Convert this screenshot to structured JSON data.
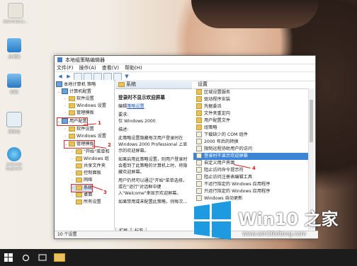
{
  "desktop": {
    "icons": [
      {
        "label": "Administra...",
        "icon": "user-folder-icon"
      },
      {
        "label": "此电脑",
        "icon": "computer-icon"
      },
      {
        "label": "网络",
        "icon": "network-icon"
      },
      {
        "label": "回收站",
        "icon": "recycle-bin-icon"
      },
      {
        "label": "Internet Explorer",
        "icon": "ie-icon"
      }
    ]
  },
  "window": {
    "title": "本地组策略编辑器",
    "menu": [
      "文件(F)",
      "操作(A)",
      "查看(V)",
      "帮助(H)"
    ],
    "tree": {
      "root": "本地计算机 策略",
      "items": [
        {
          "label": "计算机配置",
          "level": 1
        },
        {
          "label": "软件设置",
          "level": 2
        },
        {
          "label": "Windows 设置",
          "level": 2
        },
        {
          "label": "管理模板",
          "level": 2
        },
        {
          "label": "用户配置",
          "level": 1
        },
        {
          "label": "软件设置",
          "level": 2
        },
        {
          "label": "Windows 设置",
          "level": 2
        },
        {
          "label": "管理模板",
          "level": 2
        },
        {
          "label": "\"开始\"菜单和",
          "level": 3
        },
        {
          "label": "Windows 组",
          "level": 3
        },
        {
          "label": "共享文件夹",
          "level": 3
        },
        {
          "label": "控制面板",
          "level": 3
        },
        {
          "label": "网络",
          "level": 3
        },
        {
          "label": "系统",
          "level": 3
        },
        {
          "label": "桌面",
          "level": 3
        },
        {
          "label": "所有设置",
          "level": 3
        }
      ]
    },
    "middle": {
      "header": "系统",
      "title": "登录时不显示欢迎屏幕",
      "edit_prefix": "编辑",
      "edit_link": "策略设置",
      "req_label": "要求:",
      "req_value": "仅 Windows 2000",
      "desc_label": "描述:",
      "p1": "此策略设置隐藏每次用户登录时在 Windows 2000 Professional 上显示的欢迎屏幕。",
      "p2": "如果启用此策略设置，则用户登录时会看到了此策略的计算机上时，将隐藏欢迎屏幕。",
      "p3": "用户仍然可以通过\"开始\"菜单选择，或在\"运行\"对话框中键入\"Welcome\"来显示欢迎屏幕。",
      "p4": "如果禁用或未配置此策略，则每次..."
    },
    "right": {
      "header": "设置",
      "rows": [
        "区域设置服务",
        "驱动程序安装",
        "凭据委派",
        "文件夹重定向",
        "用户配置文件",
        "组策略",
        "下载缺少的 COM 组件",
        "2000 年后的转换",
        "限制远程协助用户的访问",
        "登录时不显示欢迎屏幕",
        "自定义用户界面",
        "阻止访问命令提示符",
        "阻止访问注册表编辑工具",
        "不运行指定的 Windows 应用程序",
        "只运行指定的 Windows 应用程序",
        "Windows 自动更新"
      ],
      "active_index": 9
    },
    "tabs": [
      "扩展",
      "标准"
    ],
    "status": "10 个设置"
  },
  "annotations": [
    "1",
    "2",
    "3",
    "4"
  ],
  "watermark": {
    "title": "Win10 之家",
    "url": "www.win10xitong.com"
  },
  "colors": {
    "accent": "#3c84d6",
    "annotation": "#d62222",
    "win_logo": "#1e9be0"
  }
}
